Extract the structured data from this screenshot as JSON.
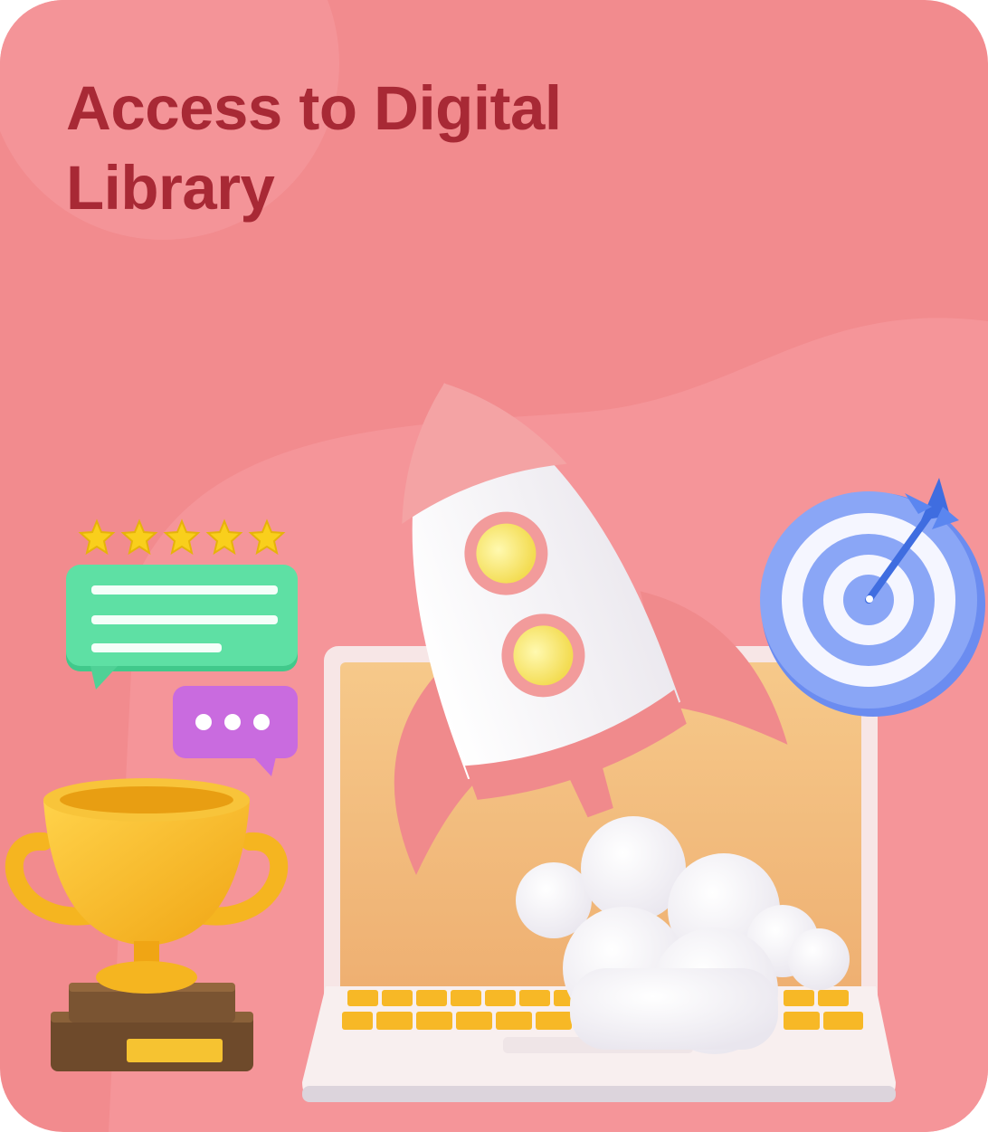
{
  "card": {
    "title": "Access to Digital Library",
    "background_color": "#f28b8e",
    "title_color": "#a82935"
  },
  "illustration": {
    "objects": [
      "rocket-icon",
      "laptop-icon",
      "target-icon",
      "dart-icon",
      "trophy-icon",
      "review-bubble-icon",
      "typing-bubble-icon",
      "star-icon",
      "cloud-icon"
    ],
    "rating_stars": 5
  }
}
